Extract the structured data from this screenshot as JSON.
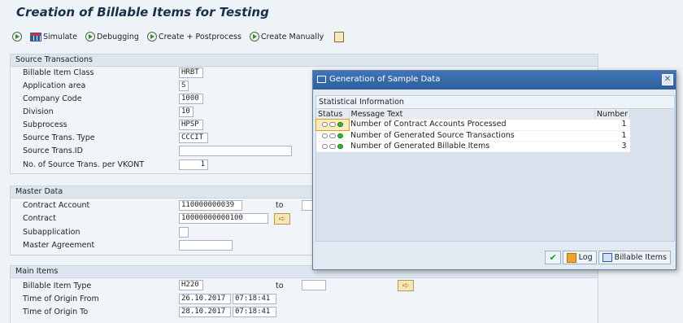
{
  "title": "Creation of Billable Items for Testing",
  "toolbar": {
    "simulate": "Simulate",
    "debugging": "Debugging",
    "create_postprocess": "Create + Postprocess",
    "create_manually": "Create Manually"
  },
  "source": {
    "header": "Source Transactions",
    "billable_item_class": {
      "label": "Billable Item Class",
      "value": "HRBT"
    },
    "application_area": {
      "label": "Application area",
      "value": "S"
    },
    "company_code": {
      "label": "Company Code",
      "value": "1000"
    },
    "division": {
      "label": "Division",
      "value": "10"
    },
    "subprocess": {
      "label": "Subprocess",
      "value": "HPSP"
    },
    "source_trans_type": {
      "label": "Source Trans. Type",
      "value": "CCCIT"
    },
    "source_trans_id": {
      "label": "Source Trans.ID",
      "value": ""
    },
    "no_source_trans": {
      "label": "No. of Source Trans. per VKONT",
      "value": "1"
    }
  },
  "master": {
    "header": "Master Data",
    "contract_account": {
      "label": "Contract Account",
      "value": "110000000039",
      "to": "to"
    },
    "contract": {
      "label": "Contract",
      "value": "10000000000100"
    },
    "subapplication": {
      "label": "Subapplication",
      "value": ""
    },
    "master_agreement": {
      "label": "Master Agreement",
      "value": ""
    }
  },
  "main": {
    "header": "Main Items",
    "billable_item_type": {
      "label": "Billable Item Type",
      "value": "H220",
      "to": "to"
    },
    "time_from": {
      "label": "Time of Origin From",
      "date": "26.10.2017",
      "time": "07:18:41"
    },
    "time_to": {
      "label": "Time of Origin To",
      "date": "28.10.2017",
      "time": "07:18:41"
    }
  },
  "dialog": {
    "title": "Generation of Sample Data",
    "section": "Statistical Information",
    "columns": [
      "Status",
      "Message Text",
      "Number"
    ],
    "rows": [
      {
        "status": "green",
        "text": "Number of Contract Accounts Processed",
        "number": "1"
      },
      {
        "status": "green",
        "text": "Number of Generated Source Transactions",
        "number": "1"
      },
      {
        "status": "green",
        "text": "Number of Generated Billable Items",
        "number": "3"
      }
    ],
    "buttons": {
      "log": "Log",
      "billable_items": "Billable Items"
    }
  }
}
